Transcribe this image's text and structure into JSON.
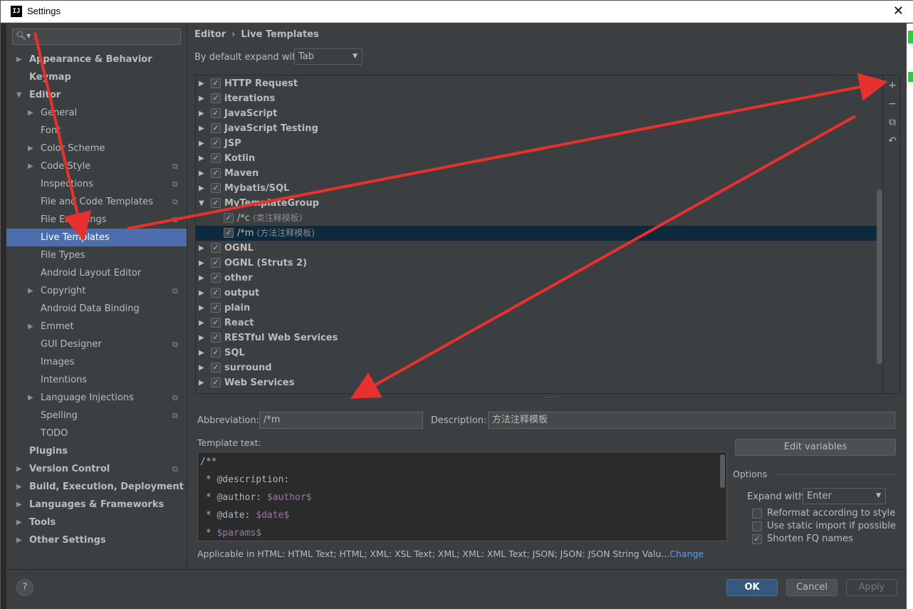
{
  "window": {
    "title": "Settings",
    "icon": "intellij-icon"
  },
  "sidebar": {
    "search_placeholder": "",
    "items": [
      {
        "label": "Appearance & Behavior",
        "level": 0,
        "arrow": "right",
        "bold": true
      },
      {
        "label": "Keymap",
        "level": 0,
        "arrow": "",
        "bold": true
      },
      {
        "label": "Editor",
        "level": 0,
        "arrow": "down",
        "bold": true
      },
      {
        "label": "General",
        "level": 1,
        "arrow": "right"
      },
      {
        "label": "Font",
        "level": 1,
        "arrow": ""
      },
      {
        "label": "Color Scheme",
        "level": 1,
        "arrow": "right"
      },
      {
        "label": "Code Style",
        "level": 1,
        "arrow": "right",
        "copy": true
      },
      {
        "label": "Inspections",
        "level": 1,
        "arrow": "",
        "copy": true
      },
      {
        "label": "File and Code Templates",
        "level": 1,
        "arrow": "",
        "copy": true
      },
      {
        "label": "File Encodings",
        "level": 1,
        "arrow": "",
        "copy": true
      },
      {
        "label": "Live Templates",
        "level": 1,
        "arrow": "",
        "selected": true
      },
      {
        "label": "File Types",
        "level": 1,
        "arrow": ""
      },
      {
        "label": "Android Layout Editor",
        "level": 1,
        "arrow": ""
      },
      {
        "label": "Copyright",
        "level": 1,
        "arrow": "right",
        "copy": true
      },
      {
        "label": "Android Data Binding",
        "level": 1,
        "arrow": ""
      },
      {
        "label": "Emmet",
        "level": 1,
        "arrow": "right"
      },
      {
        "label": "GUI Designer",
        "level": 1,
        "arrow": "",
        "copy": true
      },
      {
        "label": "Images",
        "level": 1,
        "arrow": ""
      },
      {
        "label": "Intentions",
        "level": 1,
        "arrow": ""
      },
      {
        "label": "Language Injections",
        "level": 1,
        "arrow": "right",
        "copy": true
      },
      {
        "label": "Spelling",
        "level": 1,
        "arrow": "",
        "copy": true
      },
      {
        "label": "TODO",
        "level": 1,
        "arrow": ""
      },
      {
        "label": "Plugins",
        "level": 0,
        "arrow": "",
        "bold": true
      },
      {
        "label": "Version Control",
        "level": 0,
        "arrow": "right",
        "bold": true,
        "copy": true
      },
      {
        "label": "Build, Execution, Deployment",
        "level": 0,
        "arrow": "right",
        "bold": true
      },
      {
        "label": "Languages & Frameworks",
        "level": 0,
        "arrow": "right",
        "bold": true
      },
      {
        "label": "Tools",
        "level": 0,
        "arrow": "right",
        "bold": true
      },
      {
        "label": "Other Settings",
        "level": 0,
        "arrow": "right",
        "bold": true
      }
    ]
  },
  "breadcrumb": {
    "parent": "Editor",
    "separator": "›",
    "current": "Live Templates"
  },
  "expand_default": {
    "label": "By default expand with",
    "value": "Tab"
  },
  "templates": [
    {
      "type": "group",
      "name": "HTTP Request",
      "expanded": false,
      "checked": true
    },
    {
      "type": "group",
      "name": "iterations",
      "expanded": false,
      "checked": true
    },
    {
      "type": "group",
      "name": "JavaScript",
      "expanded": false,
      "checked": true
    },
    {
      "type": "group",
      "name": "JavaScript Testing",
      "expanded": false,
      "checked": true
    },
    {
      "type": "group",
      "name": "JSP",
      "expanded": false,
      "checked": true
    },
    {
      "type": "group",
      "name": "Kotlin",
      "expanded": false,
      "checked": true
    },
    {
      "type": "group",
      "name": "Maven",
      "expanded": false,
      "checked": true
    },
    {
      "type": "group",
      "name": "Mybatis/SQL",
      "expanded": false,
      "checked": true
    },
    {
      "type": "group",
      "name": "MyTemplateGroup",
      "expanded": true,
      "checked": true
    },
    {
      "type": "template",
      "abbr": "/*c",
      "desc": "(类注释模板)",
      "checked": true
    },
    {
      "type": "template",
      "abbr": "/*m",
      "desc": "(方法注释模板)",
      "checked": true,
      "selected": true
    },
    {
      "type": "group",
      "name": "OGNL",
      "expanded": false,
      "checked": true
    },
    {
      "type": "group",
      "name": "OGNL (Struts 2)",
      "expanded": false,
      "checked": true
    },
    {
      "type": "group",
      "name": "other",
      "expanded": false,
      "checked": true
    },
    {
      "type": "group",
      "name": "output",
      "expanded": false,
      "checked": true
    },
    {
      "type": "group",
      "name": "plain",
      "expanded": false,
      "checked": true
    },
    {
      "type": "group",
      "name": "React",
      "expanded": false,
      "checked": true
    },
    {
      "type": "group",
      "name": "RESTful Web Services",
      "expanded": false,
      "checked": true
    },
    {
      "type": "group",
      "name": "SQL",
      "expanded": false,
      "checked": true
    },
    {
      "type": "group",
      "name": "surround",
      "expanded": false,
      "checked": true
    },
    {
      "type": "group",
      "name": "Web Services",
      "expanded": false,
      "checked": true
    }
  ],
  "toolbar": {
    "add": "+",
    "remove": "−",
    "copy": "⧉",
    "revert": "↶"
  },
  "abbreviation": {
    "label": "Abbreviation:",
    "value": "/*m"
  },
  "description": {
    "label": "Description:",
    "value": "方法注释模板"
  },
  "template_text": {
    "label": "Template text:",
    "lines": [
      {
        "text": "/**",
        "var": ""
      },
      {
        "text": " * @description:",
        "var": ""
      },
      {
        "text": " * @author: ",
        "var": "$author$"
      },
      {
        "text": " * @date: ",
        "var": "$date$"
      },
      {
        "text": " * ",
        "var": "$params$"
      }
    ]
  },
  "edit_variables": "Edit variables",
  "options": {
    "title": "Options",
    "expand_with_label": "Expand with",
    "expand_with_value": "Enter",
    "reformat": {
      "label": "Reformat according to style",
      "checked": false
    },
    "static_import": {
      "label": "Use static import if possible",
      "checked": false
    },
    "shorten_fq": {
      "label": "Shorten FQ names",
      "checked": true
    }
  },
  "applicable": {
    "text": "Applicable in HTML: HTML Text; HTML; XML: XSL Text; XML; XML: XML Text; JSON; JSON: JSON String Valu...",
    "link": "Change"
  },
  "footer": {
    "help": "?",
    "ok": "OK",
    "cancel": "Cancel",
    "apply": "Apply"
  },
  "annotation_color": "#e8312f"
}
